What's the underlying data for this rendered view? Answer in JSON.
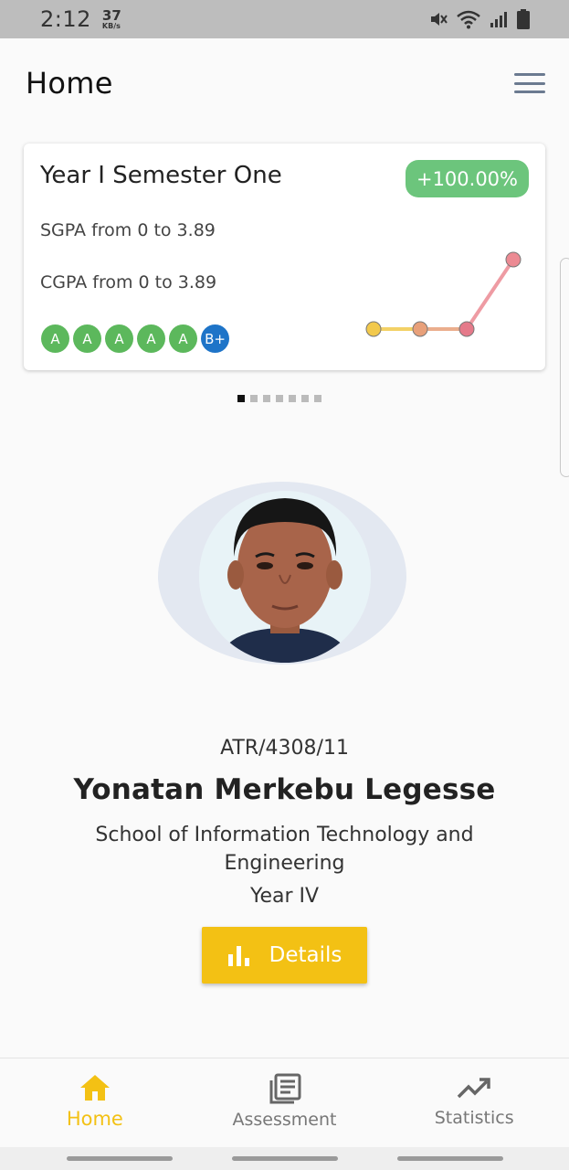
{
  "status_bar": {
    "time": "2:12",
    "network_speed": "37",
    "network_unit": "KB/s",
    "icons": [
      "mute-icon",
      "wifi-icon",
      "signal-icon",
      "battery-icon"
    ]
  },
  "header": {
    "title": "Home",
    "menu_icon": "hamburger-menu-icon"
  },
  "semester_card": {
    "title": "Year I Semester One",
    "growth_badge": "+100.00%",
    "sgpa_text": "SGPA from 0 to 3.89",
    "cgpa_text": "CGPA from 0 to 3.89",
    "grades": [
      {
        "grade": "A",
        "color": "#5cb85c"
      },
      {
        "grade": "A",
        "color": "#5cb85c"
      },
      {
        "grade": "A",
        "color": "#5cb85c"
      },
      {
        "grade": "A",
        "color": "#5cb85c"
      },
      {
        "grade": "A",
        "color": "#5cb85c"
      },
      {
        "grade": "B+",
        "color": "#1e74c8"
      }
    ],
    "trend_colors": [
      "#f2c94c",
      "#e8a07a",
      "#e57a8a",
      "#ec8a93"
    ],
    "trend_values": [
      0,
      0,
      0,
      3.89
    ]
  },
  "pager": {
    "count": 7,
    "active_index": 0
  },
  "profile": {
    "avatar_icon": "student-photo",
    "student_id": "ATR/4308/11",
    "name": "Yonatan Merkebu Legesse",
    "school": "School of Information Technology and Engineering",
    "year": "Year IV",
    "details_label": "Details",
    "details_icon": "bar-chart-icon"
  },
  "bottom_nav": {
    "items": [
      {
        "label": "Home",
        "icon": "home-icon",
        "active": true
      },
      {
        "label": "Assessment",
        "icon": "newspaper-icon",
        "active": false
      },
      {
        "label": "Statistics",
        "icon": "trending-up-icon",
        "active": false
      }
    ]
  },
  "colors": {
    "accent": "#f3c114",
    "success_badge": "#6cc57c",
    "grade_a": "#5cb85c",
    "grade_b_plus": "#1e74c8"
  }
}
